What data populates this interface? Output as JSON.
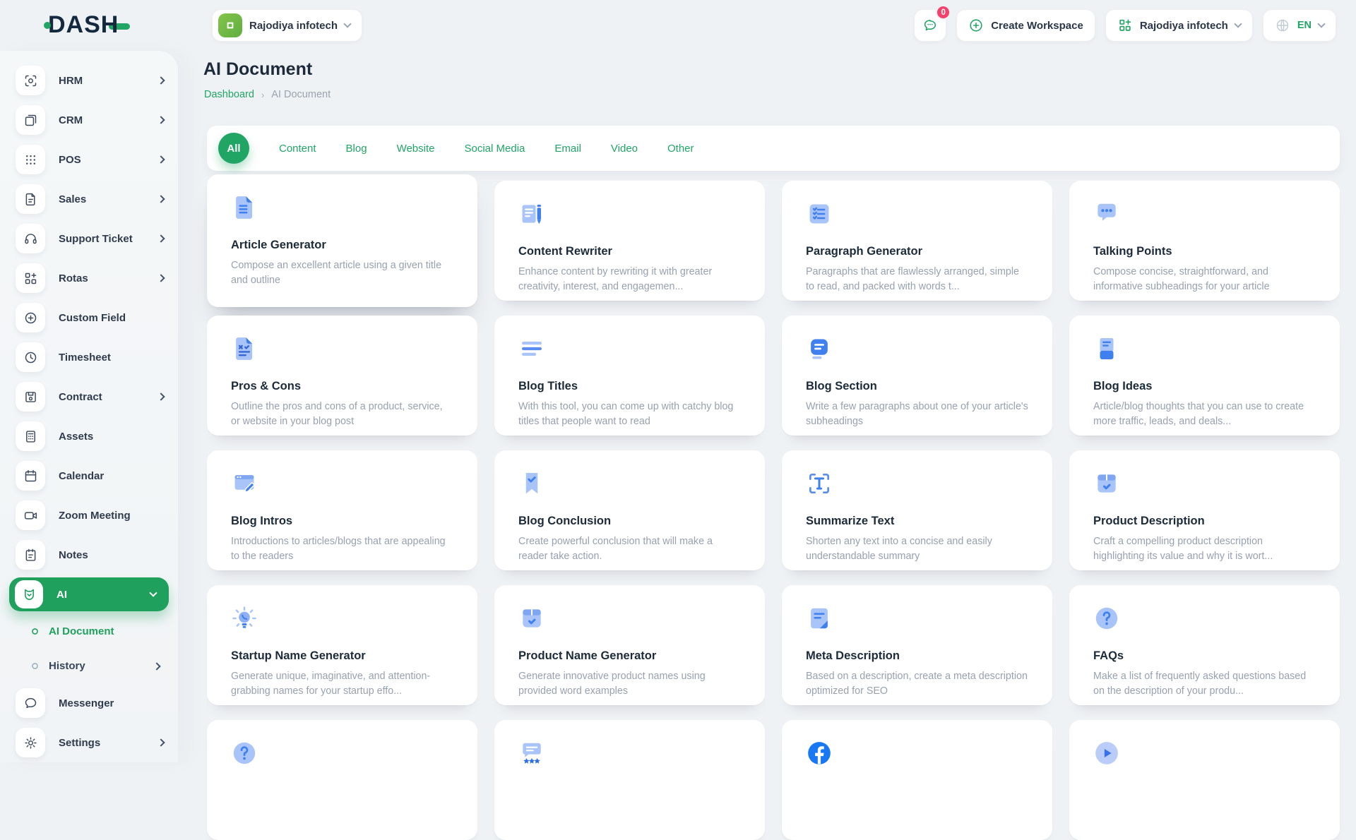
{
  "header": {
    "logo": "DASH",
    "workspace_selector": {
      "label": "Rajodiya infotech"
    },
    "messages": {
      "badge": "0"
    },
    "create_workspace_label": "Create Workspace",
    "account_selector": {
      "label": "Rajodiya infotech"
    },
    "language_selector": {
      "label": "EN"
    }
  },
  "sidebar": {
    "items": [
      {
        "label": "HRM",
        "icon": "hrm-icon",
        "chevron": true
      },
      {
        "label": "CRM",
        "icon": "crm-icon",
        "chevron": true
      },
      {
        "label": "POS",
        "icon": "pos-icon",
        "chevron": true
      },
      {
        "label": "Sales",
        "icon": "sales-icon",
        "chevron": true
      },
      {
        "label": "Support Ticket",
        "icon": "support-ticket-icon",
        "chevron": true
      },
      {
        "label": "Rotas",
        "icon": "rotas-icon",
        "chevron": true
      },
      {
        "label": "Custom Field",
        "icon": "custom-field-icon",
        "chevron": false
      },
      {
        "label": "Timesheet",
        "icon": "timesheet-icon",
        "chevron": false
      },
      {
        "label": "Contract",
        "icon": "contract-icon",
        "chevron": true
      },
      {
        "label": "Assets",
        "icon": "assets-icon",
        "chevron": false
      },
      {
        "label": "Calendar",
        "icon": "calendar-icon",
        "chevron": false
      },
      {
        "label": "Zoom Meeting",
        "icon": "zoom-meeting-icon",
        "chevron": false
      },
      {
        "label": "Notes",
        "icon": "notes-icon",
        "chevron": false
      },
      {
        "label": "AI",
        "icon": "ai-icon",
        "chevron": "down",
        "active": true
      }
    ],
    "ai_sub_items": [
      {
        "label": "AI Document",
        "active": true,
        "chevron": false
      },
      {
        "label": "History",
        "chevron": true
      }
    ],
    "footer_items": [
      {
        "label": "Messenger",
        "icon": "messenger-icon",
        "chevron": false
      },
      {
        "label": "Settings",
        "icon": "settings-icon",
        "chevron": true
      }
    ]
  },
  "page": {
    "title": "AI Document",
    "breadcrumb": {
      "home": "Dashboard",
      "separator": "›",
      "current": "AI Document"
    }
  },
  "filter_tabs": [
    {
      "label": "All",
      "active": true
    },
    {
      "label": "Content"
    },
    {
      "label": "Blog"
    },
    {
      "label": "Website"
    },
    {
      "label": "Social Media"
    },
    {
      "label": "Email"
    },
    {
      "label": "Video"
    },
    {
      "label": "Other"
    }
  ],
  "tools": [
    {
      "title": "Article Generator",
      "description": "Compose an excellent article using a given title and outline",
      "icon": "article-generator-icon",
      "featured": true
    },
    {
      "title": "Content Rewriter",
      "description": "Enhance content by rewriting it with greater creativity, interest, and engagemen...",
      "icon": "content-rewriter-icon"
    },
    {
      "title": "Paragraph Generator",
      "description": "Paragraphs that are flawlessly arranged, simple to read, and packed with words t...",
      "icon": "paragraph-generator-icon"
    },
    {
      "title": "Talking Points",
      "description": "Compose concise, straightforward, and informative subheadings for your article",
      "icon": "talking-points-icon"
    },
    {
      "title": "Pros & Cons",
      "description": "Outline the pros and cons of a product, service, or website in your blog post",
      "icon": "pros-cons-icon"
    },
    {
      "title": "Blog Titles",
      "description": "With this tool, you can come up with catchy blog titles that people want to read",
      "icon": "blog-titles-icon"
    },
    {
      "title": "Blog Section",
      "description": "Write a few paragraphs about one of your article's subheadings",
      "icon": "blog-section-icon"
    },
    {
      "title": "Blog Ideas",
      "description": "Article/blog thoughts that you can use to create more traffic, leads, and deals...",
      "icon": "blog-ideas-icon"
    },
    {
      "title": "Blog Intros",
      "description": "Introductions to articles/blogs that are appealing to the readers",
      "icon": "blog-intros-icon"
    },
    {
      "title": "Blog Conclusion",
      "description": "Create powerful conclusion that will make a reader take action.",
      "icon": "blog-conclusion-icon"
    },
    {
      "title": "Summarize Text",
      "description": "Shorten any text into a concise and easily understandable summary",
      "icon": "summarize-text-icon"
    },
    {
      "title": "Product Description",
      "description": "Craft a compelling product description highlighting its value and why it is wort...",
      "icon": "product-description-icon"
    },
    {
      "title": "Startup Name Generator",
      "description": "Generate unique, imaginative, and attention-grabbing names for your startup effo...",
      "icon": "startup-name-icon"
    },
    {
      "title": "Product Name Generator",
      "description": "Generate innovative product names using provided word examples",
      "icon": "product-name-icon"
    },
    {
      "title": "Meta Description",
      "description": "Based on a description, create a meta description optimized for SEO",
      "icon": "meta-description-icon"
    },
    {
      "title": "FAQs",
      "description": "Make a list of frequently asked questions based on the description of your produ...",
      "icon": "faqs-icon"
    }
  ],
  "more_tools_partial": [
    {
      "icon": "faqs-icon"
    },
    {
      "icon": "review-stars-icon"
    },
    {
      "icon": "facebook-icon"
    },
    {
      "icon": "play-icon"
    }
  ],
  "icon_names": [
    "chat-icon",
    "plus-circle-icon",
    "workspace-grid-icon",
    "globe-icon",
    "workspace-logo-icon",
    "chevron-down-icon",
    "chevron-right-icon",
    "dot-icon"
  ],
  "colors": {
    "accent_green": "#21a565",
    "card_icon_blue": "#4080ee",
    "card_icon_light_blue": "#a9c4f8",
    "badge_pink": "#f5426c",
    "facebook_blue": "#1877f2",
    "text_dark": "#1c2a3a",
    "text_muted": "#98a1b0"
  }
}
